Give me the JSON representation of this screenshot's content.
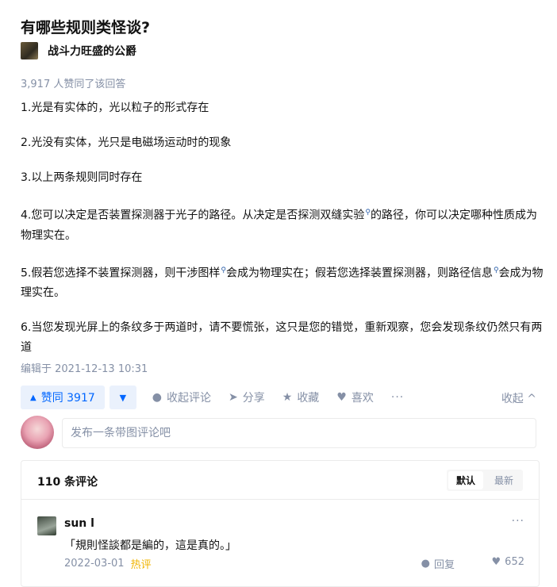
{
  "question": {
    "title": "有哪些规则类怪谈?"
  },
  "author": {
    "name": "战斗力旺盛的公爵"
  },
  "answer": {
    "vote_summary": "3,917 人赞同了该回答",
    "paragraphs": [
      {
        "text": "1.光是有实体的，光以粒子的形式存在"
      },
      {
        "text": "2.光没有实体，光只是电磁场运动时的现象"
      },
      {
        "text": "3.以上两条规则同时存在"
      },
      {
        "text_before": "4.您可以决定是否装置探测器于光子的路径。从决定是否探测双缝实验",
        "text_after": "的路径，你可以决定哪种性质成为物理实在。"
      },
      {
        "text_a": "5.假若您选择不装置探测器，则干涉图样",
        "text_b": "会成为物理实在；假若您选择装置探测器，则路径信息",
        "text_c": "会成为物理实在。"
      },
      {
        "text": "6.当您发现光屏上的条纹多于两道时，请不要慌张，这只是您的错觉，重新观察，您会发现条纹仍然只有两道"
      }
    ],
    "edit_time": "编辑于 2021-12-13 10:31"
  },
  "actions": {
    "vote_up": "赞同 3917",
    "collapse_comments": "收起评论",
    "share": "分享",
    "favorite": "收藏",
    "like": "喜欢",
    "more": "···",
    "collapse": "收起 ^"
  },
  "comment_box": {
    "placeholder": "发布一条带图评论吧"
  },
  "comments": {
    "count_label": "110 条评论",
    "sort_default": "默认",
    "sort_latest": "最新",
    "items": [
      {
        "author": "sun l",
        "text": "「規則怪談都是編的，這是真的。」",
        "date": "2022-03-01",
        "tag": "热评",
        "reply": "回复",
        "likes": "652",
        "more": "···"
      }
    ]
  }
}
